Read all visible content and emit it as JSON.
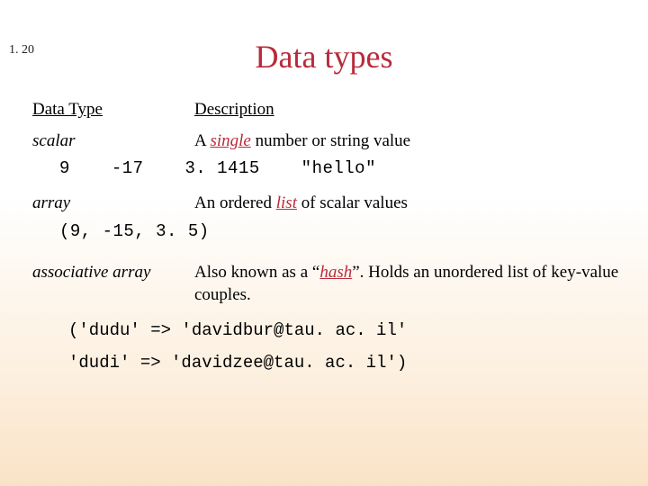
{
  "slide_number": "1. 20",
  "title": "Data types",
  "header": {
    "type": "Data Type",
    "desc": "Description"
  },
  "scalar": {
    "name": "scalar",
    "desc_pre": "A ",
    "desc_kw": "single",
    "desc_post": " number or string value",
    "examples": [
      "9",
      "-17",
      "3. 1415",
      "\"hello\""
    ]
  },
  "array": {
    "name": "array",
    "desc_pre": "An ordered ",
    "desc_kw": "list",
    "desc_post": " of scalar values",
    "example": "(9, -15, 3. 5)"
  },
  "assoc": {
    "name": "associative array",
    "desc_pre": "Also known as a “",
    "desc_kw": "hash",
    "desc_post": "”.  Holds an unordered list of key-value couples.",
    "line1": "('dudu' => 'davidbur@tau. ac. il'",
    "line2": " 'dudi' => 'davidzee@tau. ac. il')"
  }
}
